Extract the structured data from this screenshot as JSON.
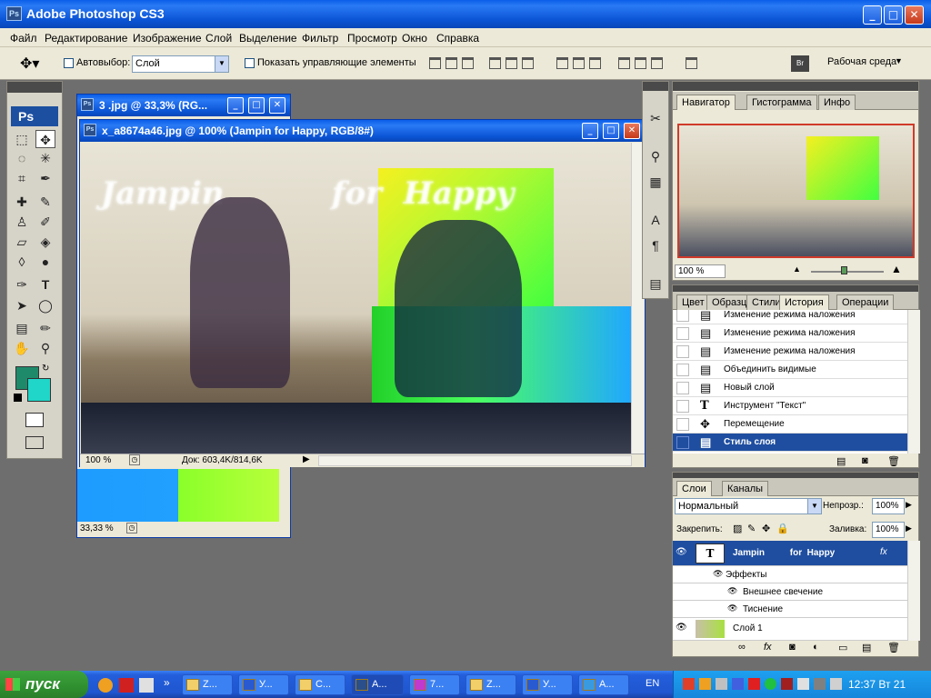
{
  "app": {
    "title": "Adobe Photoshop CS3",
    "logo": "Ps"
  },
  "menu": [
    "Файл",
    "Редактирование",
    "Изображение",
    "Слой",
    "Выделение",
    "Фильтр",
    "Просмотр",
    "Окно",
    "Справка"
  ],
  "options": {
    "autoselect_label": "Автовыбор:",
    "autoselect_value": "Слой",
    "show_controls_label": "Показать управляющие элементы",
    "workspace_label": "Рабочая среда"
  },
  "toolbox": {
    "logo": "Ps",
    "fg_color": "#1f8a6a",
    "bg_color": "#1fd6c8"
  },
  "doc_back": {
    "title": "3 .jpg @ 33,3% (RG...",
    "zoom": "33,33 %"
  },
  "doc_front": {
    "title": "x_a8674a46.jpg @ 100% (Jampin          for  Happy, RGB/8#)",
    "zoom": "100 %",
    "doc_info": "Док: 603,4K/814,6K",
    "overlay_text": "Jampin          for  Happy"
  },
  "navigator": {
    "tabs": [
      "Навигатор",
      "Гистограмма",
      "Инфо"
    ],
    "zoom": "100 %"
  },
  "history": {
    "tabs": [
      "Цвет",
      "Образцы",
      "Стили",
      "История",
      "Операции"
    ],
    "items": [
      {
        "label": "Изменение режима наложения",
        "icon": "doc-icon"
      },
      {
        "label": "Изменение режима наложения",
        "icon": "doc-icon"
      },
      {
        "label": "Изменение режима наложения",
        "icon": "doc-icon"
      },
      {
        "label": "Объединить видимые",
        "icon": "doc-icon"
      },
      {
        "label": "Новый слой",
        "icon": "doc-icon"
      },
      {
        "label": "Инструмент \"Текст\"",
        "icon": "text-icon"
      },
      {
        "label": "Перемещение",
        "icon": "move-icon"
      },
      {
        "label": "Стиль слоя",
        "icon": "doc-icon"
      }
    ]
  },
  "layers": {
    "tabs": [
      "Слои",
      "Каналы"
    ],
    "blend_mode": "Нормальный",
    "opacity_label": "Непрозр.:",
    "opacity": "100%",
    "lock_label": "Закрепить:",
    "fill_label": "Заливка:",
    "fill": "100%",
    "text_layer": "Jampin          for  Happy",
    "effects_label": "Эффекты",
    "effect1": "Внешнее свечение",
    "effect2": "Тиснение",
    "layer1": "Слой 1"
  },
  "taskbar": {
    "start": "пуск",
    "tasks": [
      "Z...",
      "У...",
      "C...",
      "A...",
      "7...",
      "Z...",
      "У...",
      "A..."
    ],
    "lang": "EN",
    "clock": "12:37 Вт 21"
  }
}
